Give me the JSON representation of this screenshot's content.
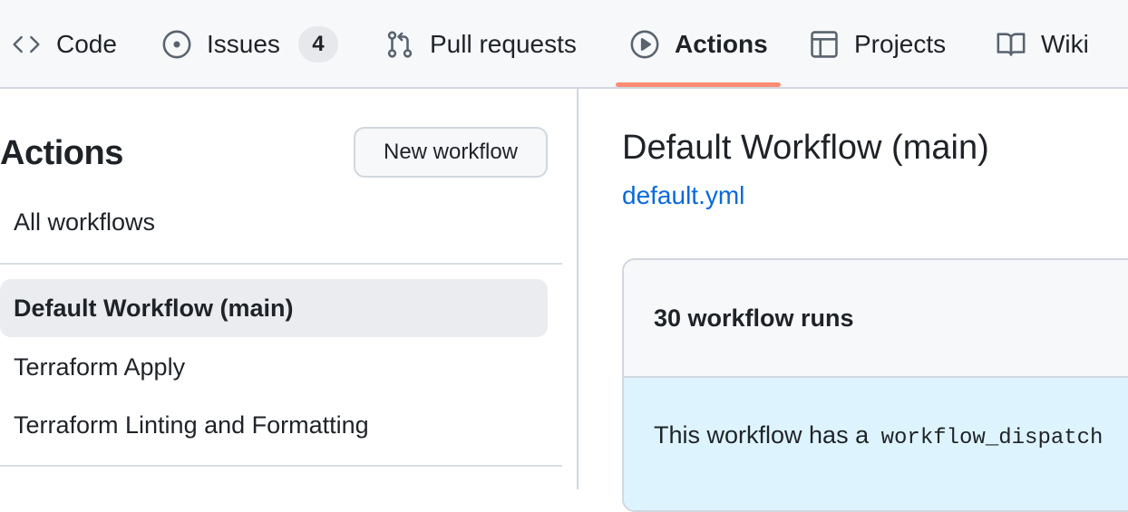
{
  "repo_nav": {
    "items": [
      {
        "label": "Code",
        "icon": "code-icon"
      },
      {
        "label": "Issues",
        "icon": "issue-opened-icon",
        "counter": "4"
      },
      {
        "label": "Pull requests",
        "icon": "git-pull-request-icon"
      },
      {
        "label": "Actions",
        "icon": "play-icon",
        "selected": true
      },
      {
        "label": "Projects",
        "icon": "table-icon"
      },
      {
        "label": "Wiki",
        "icon": "book-icon"
      }
    ],
    "selected_underline_color": "#fd8c73"
  },
  "sidebar": {
    "title": "Actions",
    "new_workflow_label": "New workflow",
    "all_workflows_label": "All workflows",
    "workflows": [
      {
        "label": "Default Workflow (main)",
        "active": true
      },
      {
        "label": "Terraform Apply"
      },
      {
        "label": "Terraform Linting and Formatting"
      }
    ]
  },
  "main": {
    "title": "Default Workflow (main)",
    "file_link": "default.yml",
    "runs_count_label": "30 workflow runs",
    "dispatch_notice_prefix": "This workflow has a",
    "dispatch_notice_code": "workflow_dispatch"
  },
  "colors": {
    "nav_bg": "#f6f8fa",
    "link": "#0969da",
    "banner_bg": "#ddf4ff",
    "active_item_bg": "#eaecef"
  }
}
